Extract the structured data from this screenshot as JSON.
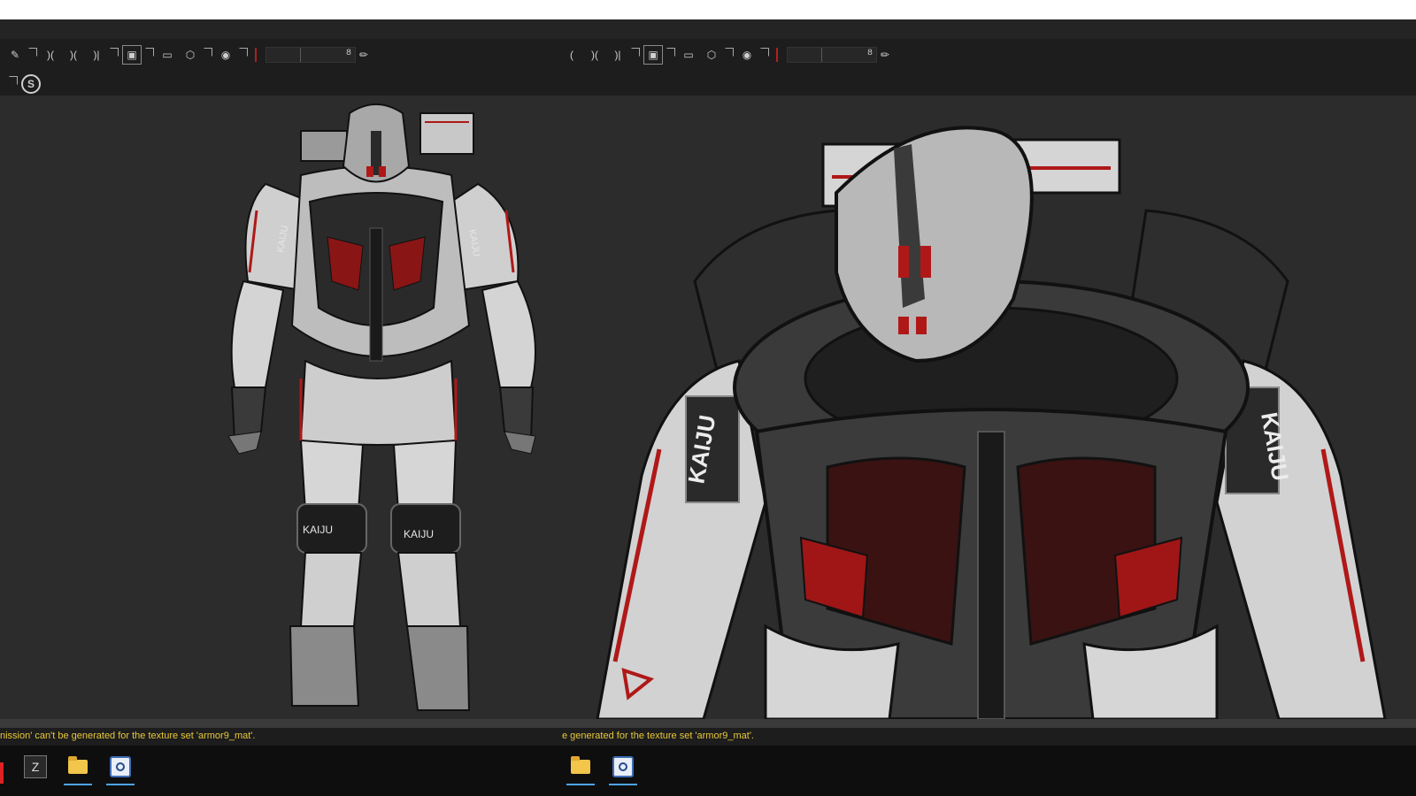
{
  "toolbar_left": {
    "icons": [
      "paint-brush-icon",
      "symmetry-x-icon",
      "symmetry-y-icon",
      "mirror-icon",
      "box-select-icon",
      "camera-view-icon",
      "3d-cube-icon",
      "screenshot-camera-icon"
    ],
    "slider_value": "8"
  },
  "toolbar_right": {
    "icons": [
      "symmetry-x-icon",
      "symmetry-y-icon",
      "mirror-icon",
      "box-select-icon",
      "camera-view-icon",
      "3d-cube-icon",
      "screenshot-camera-icon"
    ],
    "slider_value": "8"
  },
  "subbar": {
    "icon": "substance-s-icon"
  },
  "status": {
    "left_message": "nission' can't be generated for the texture set 'armor9_mat'.",
    "right_message": "e generated for the texture set 'armor9_mat'.",
    "color": "#e8c93a"
  },
  "viewports": {
    "left": {
      "subject": "Full-body sci-fi armor model, white with red and black accents",
      "labels": [
        "KAIJU",
        "KAIJU",
        "KAIJU",
        "KAIJU"
      ]
    },
    "right": {
      "subject": "Close-up of armor torso and helmet",
      "labels": [
        "KAIJU",
        "KAIJU"
      ]
    }
  },
  "taskbar": {
    "left_apps": [
      "zbrush-icon",
      "file-explorer-icon",
      "substance-painter-icon"
    ],
    "right_apps": [
      "file-explorer-icon",
      "substance-painter-icon"
    ]
  },
  "colors": {
    "viewport_bg": "#2c2c2c",
    "toolbar_bg": "#1d1d1d",
    "armor_white": "#d8d8d8",
    "armor_red": "#b01818",
    "armor_dark": "#1c1c1c"
  }
}
